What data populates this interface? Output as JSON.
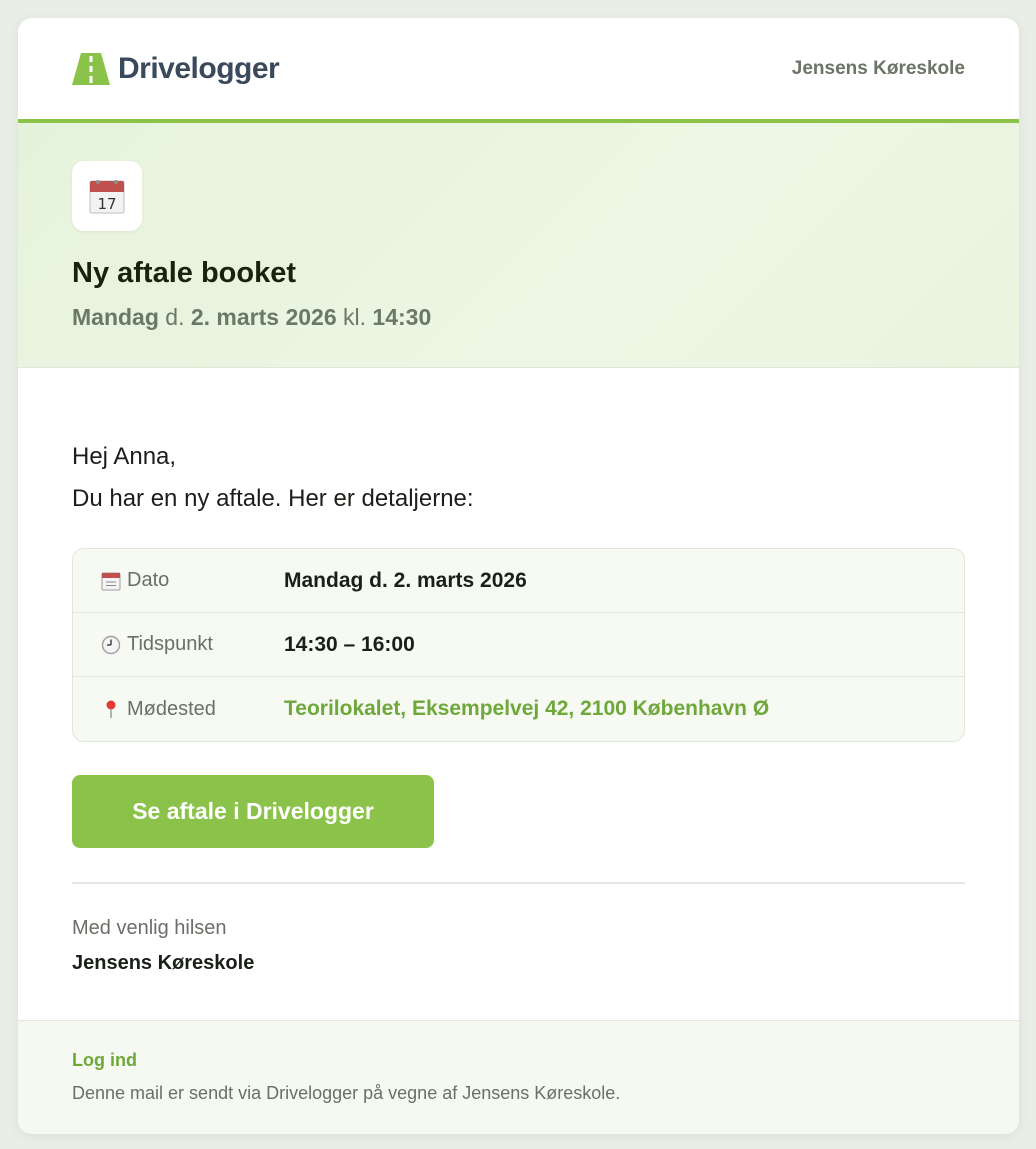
{
  "header": {
    "brand": "Drivelogger",
    "school": "Jensens Køreskole"
  },
  "hero": {
    "title": "Ny aftale booket",
    "weekday": "Mandag",
    "date_prefix": "d.",
    "date": "2. marts 2026",
    "time_prefix": "kl.",
    "time": "14:30",
    "calendar_icon_text": "17"
  },
  "body": {
    "greeting": "Hej Anna,",
    "intro": "Du har en ny aftale. Her er detaljerne:"
  },
  "details": [
    {
      "icon": "calendar-icon",
      "label": "Dato",
      "value": "Mandag d. 2. marts 2026"
    },
    {
      "icon": "clock-icon",
      "label": "Tidspunkt",
      "value": "14:30 – 16:00"
    },
    {
      "icon": "pin-icon",
      "label": "Mødested",
      "value": "Teorilokalet, Eksempelvej 42, 2100 København Ø"
    }
  ],
  "cta": {
    "label": "Se aftale i Drivelogger"
  },
  "signoff": {
    "greeting": "Med venlig hilsen",
    "name": "Jensens Køreskole"
  },
  "footer": {
    "login": "Log ind",
    "note": "Denne mail er sendt via Drivelogger på vegne af Jensens Køreskole."
  },
  "colors": {
    "accent": "#8bc34a",
    "link": "#6fa83a",
    "hero_bg": "#e6f3dc"
  }
}
